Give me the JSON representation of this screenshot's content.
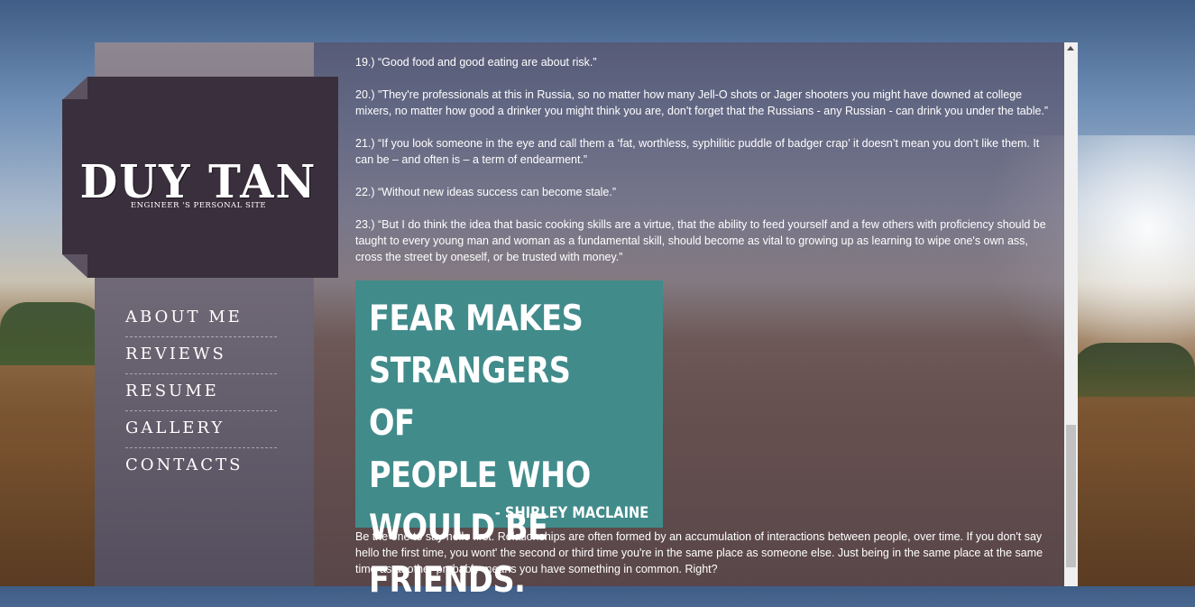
{
  "site": {
    "title": "DUY TAN",
    "subtitle": "ENGINEER 'S PERSONAL SITE"
  },
  "nav": {
    "items": [
      {
        "label": "ABOUT ME"
      },
      {
        "label": "REVIEWS"
      },
      {
        "label": "RESUME"
      },
      {
        "label": "GALLERY"
      },
      {
        "label": "CONTACTS"
      }
    ]
  },
  "article": {
    "paragraphs": [
      "19.) “Good food and good eating are about risk.”",
      "20.) \"They're professionals at this in Russia, so no matter how many Jell-O shots or Jager shooters you might have downed at college mixers, no matter how good a drinker you might think you are, don't forget that the Russians - any Russian - can drink you under the table.”",
      "21.) “If you look someone in the eye and call them a ‘fat, worthless, syphilitic puddle of badger crap’ it doesn’t mean you don’t like them. It can be – and often is – a term of endearment.”",
      "22.) “Without new ideas success can become stale.”",
      "23.) “But I do think the idea that basic cooking skills are a virtue, that the ability to feed yourself and a few others with proficiency should be taught to every young man and woman as a fundamental skill, should become as vital to growing up as learning to wipe one's own ass, cross the street by oneself, or be trusted with money.”"
    ],
    "quote_image": {
      "text": "FEAR MAKES\nSTRANGERS OF\nPEOPLE WHO\nWOULD BE FRIENDS.",
      "author": "- SHIRLEY MACLAINE",
      "bg_color": "#418b8b"
    },
    "closing": "Be the one to say hello first. Relationships are often formed by an accumulation of interactions between people, over time. If you don't say hello the first time, you wont' the second or third time you're in the same place as someone else. Just being in the same place at the same time as another probably means you have something in common. Right?"
  },
  "colors": {
    "logo_bg": "#3a2f3c",
    "sidebar": "#6f6876",
    "panel_overlay": "rgba(88,78,98,0.62)"
  }
}
